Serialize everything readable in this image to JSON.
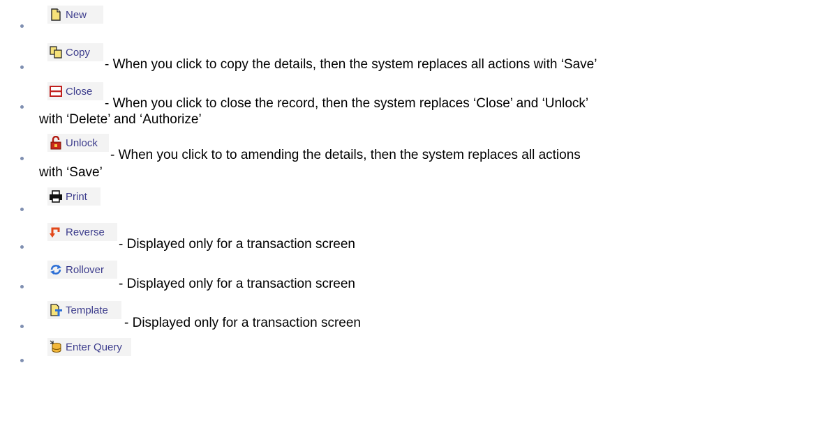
{
  "actions": [
    {
      "icon": "new-document-icon",
      "label": "New",
      "description": ""
    },
    {
      "icon": "copy-icon",
      "label": "Copy",
      "description": "- When you click to copy the details, then the system replaces all actions with ‘Save’"
    },
    {
      "icon": "close-icon",
      "label": "Close",
      "description": "- When you click to close the record, then the system replaces ‘Close’ and ‘Unlock’",
      "description_cont": "with ‘Delete’ and ‘Authorize’"
    },
    {
      "icon": "unlock-icon",
      "label": "Unlock",
      "description": "- When you click to to amending the details, then the system replaces all actions",
      "description_cont": "with ‘Save’"
    },
    {
      "icon": "printer-icon",
      "label": "Print",
      "description": ""
    },
    {
      "icon": "reverse-icon",
      "label": "Reverse",
      "description": "- Displayed only for a transaction screen"
    },
    {
      "icon": "rollover-icon",
      "label": "Rollover",
      "description": "- Displayed only for a transaction screen"
    },
    {
      "icon": "template-icon",
      "label": "Template",
      "description": "- Displayed only for a transaction screen"
    },
    {
      "icon": "enter-query-icon",
      "label": "Enter Query",
      "description": ""
    }
  ]
}
